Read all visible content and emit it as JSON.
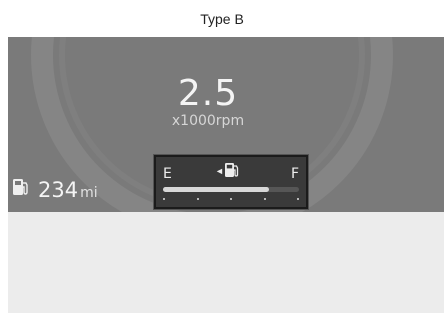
{
  "caption": "Type B",
  "tachometer": {
    "value": "2.5",
    "unit": "x1000rpm"
  },
  "range": {
    "icon": "fuel-pump-icon",
    "value": "234",
    "unit": "mi"
  },
  "fuel_gauge": {
    "empty_label": "E",
    "full_label": "F",
    "icon": "fuel-pump-icon",
    "arrow": "◄",
    "level_fraction": 0.78,
    "tick_count": 5
  },
  "colors": {
    "cluster_background": "#7a7a7a",
    "gauge_panel": "#3a3a3a",
    "fill_bar": "#d8d8d8",
    "lower_panel": "#ececec"
  }
}
